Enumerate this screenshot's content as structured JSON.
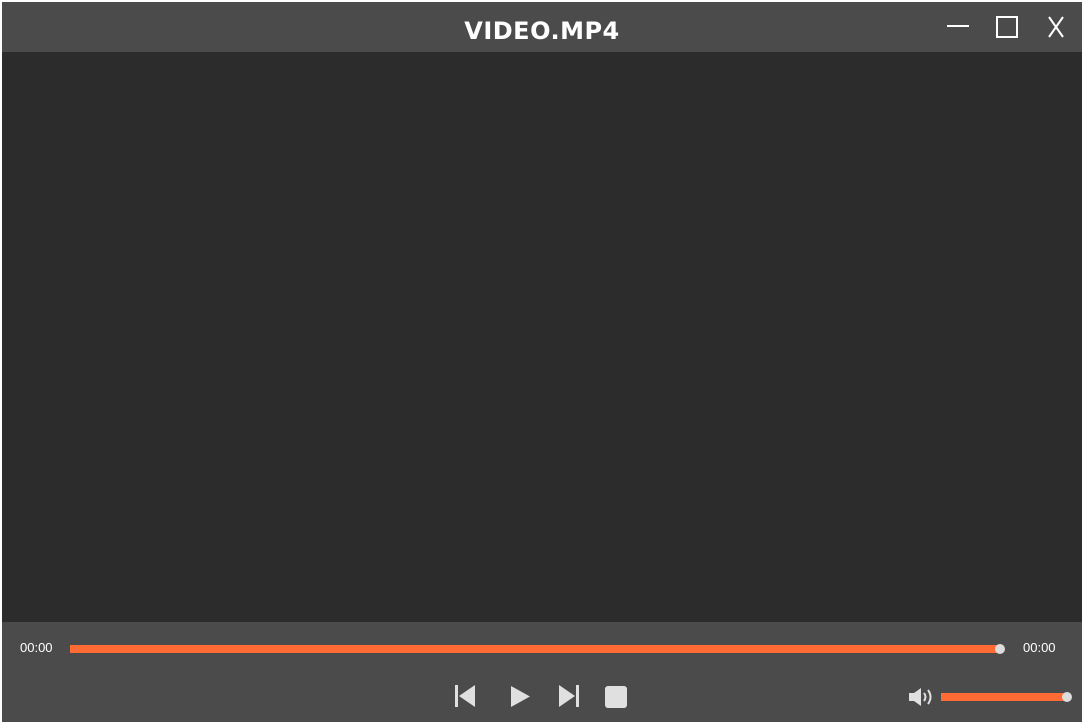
{
  "window": {
    "title": "VIDEO.MP4",
    "minimize_icon": "minimize-icon",
    "maximize_icon": "maximize-icon",
    "close_icon": "close-icon"
  },
  "player": {
    "current_time": "00:00",
    "total_time": "00:00",
    "progress_fraction": 1.0,
    "volume_fraction": 1.0,
    "buttons": {
      "previous_icon": "skip-previous-icon",
      "play_icon": "play-icon",
      "next_icon": "skip-next-icon",
      "stop_icon": "stop-icon",
      "volume_icon": "volume-icon"
    }
  },
  "colors": {
    "accent": "#ff6b35",
    "titlebar": "#4b4b4b",
    "video_bg": "#2c2c2c",
    "icon": "#e0e0e0",
    "thumb": "#dcdcdc"
  }
}
